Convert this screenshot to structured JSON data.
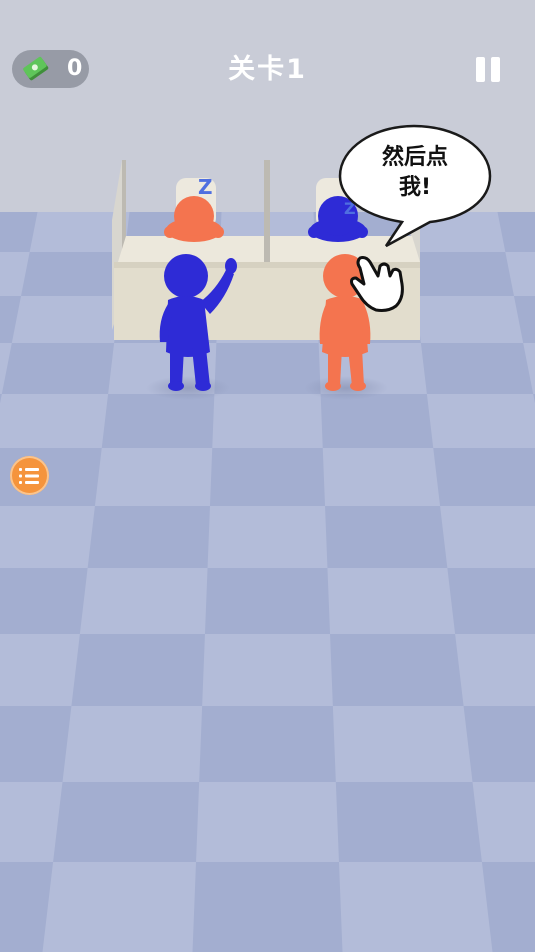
{
  "hud": {
    "cash_icon": "cash-stack-icon",
    "cash_count": "0",
    "level_title": "关卡1",
    "pause_icon": "pause-icon",
    "menu_icon": "list-icon"
  },
  "speech_bubble": {
    "line1": "然后点",
    "line2": "我!"
  },
  "sleep_marks": [
    "Z",
    "Z"
  ],
  "colors": {
    "floor_light": "#b3bcd9",
    "floor_dark": "#a3aed0",
    "wall": "#c9ccd7",
    "blue_character": "#2e2bd6",
    "orange_character": "#f4744f",
    "desk": "#e9e4d6",
    "menu_accent": "#f5943c"
  }
}
